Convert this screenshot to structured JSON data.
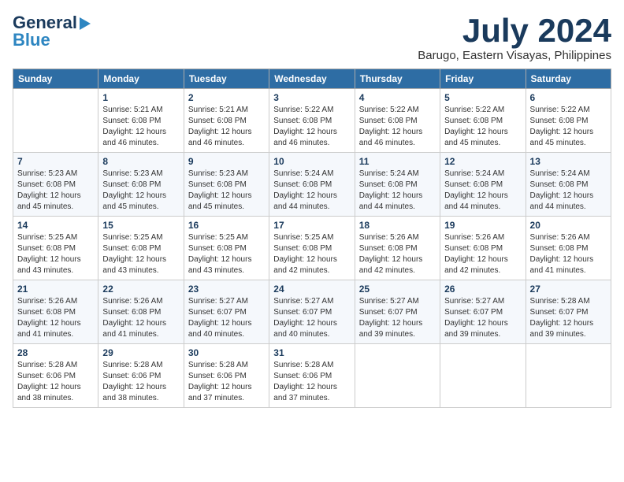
{
  "header": {
    "logo_line1": "General",
    "logo_line2": "Blue",
    "month": "July 2024",
    "location": "Barugo, Eastern Visayas, Philippines"
  },
  "days_of_week": [
    "Sunday",
    "Monday",
    "Tuesday",
    "Wednesday",
    "Thursday",
    "Friday",
    "Saturday"
  ],
  "weeks": [
    [
      {
        "day": "",
        "info": ""
      },
      {
        "day": "1",
        "info": "Sunrise: 5:21 AM\nSunset: 6:08 PM\nDaylight: 12 hours\nand 46 minutes."
      },
      {
        "day": "2",
        "info": "Sunrise: 5:21 AM\nSunset: 6:08 PM\nDaylight: 12 hours\nand 46 minutes."
      },
      {
        "day": "3",
        "info": "Sunrise: 5:22 AM\nSunset: 6:08 PM\nDaylight: 12 hours\nand 46 minutes."
      },
      {
        "day": "4",
        "info": "Sunrise: 5:22 AM\nSunset: 6:08 PM\nDaylight: 12 hours\nand 46 minutes."
      },
      {
        "day": "5",
        "info": "Sunrise: 5:22 AM\nSunset: 6:08 PM\nDaylight: 12 hours\nand 45 minutes."
      },
      {
        "day": "6",
        "info": "Sunrise: 5:22 AM\nSunset: 6:08 PM\nDaylight: 12 hours\nand 45 minutes."
      }
    ],
    [
      {
        "day": "7",
        "info": "Sunrise: 5:23 AM\nSunset: 6:08 PM\nDaylight: 12 hours\nand 45 minutes."
      },
      {
        "day": "8",
        "info": "Sunrise: 5:23 AM\nSunset: 6:08 PM\nDaylight: 12 hours\nand 45 minutes."
      },
      {
        "day": "9",
        "info": "Sunrise: 5:23 AM\nSunset: 6:08 PM\nDaylight: 12 hours\nand 45 minutes."
      },
      {
        "day": "10",
        "info": "Sunrise: 5:24 AM\nSunset: 6:08 PM\nDaylight: 12 hours\nand 44 minutes."
      },
      {
        "day": "11",
        "info": "Sunrise: 5:24 AM\nSunset: 6:08 PM\nDaylight: 12 hours\nand 44 minutes."
      },
      {
        "day": "12",
        "info": "Sunrise: 5:24 AM\nSunset: 6:08 PM\nDaylight: 12 hours\nand 44 minutes."
      },
      {
        "day": "13",
        "info": "Sunrise: 5:24 AM\nSunset: 6:08 PM\nDaylight: 12 hours\nand 44 minutes."
      }
    ],
    [
      {
        "day": "14",
        "info": "Sunrise: 5:25 AM\nSunset: 6:08 PM\nDaylight: 12 hours\nand 43 minutes."
      },
      {
        "day": "15",
        "info": "Sunrise: 5:25 AM\nSunset: 6:08 PM\nDaylight: 12 hours\nand 43 minutes."
      },
      {
        "day": "16",
        "info": "Sunrise: 5:25 AM\nSunset: 6:08 PM\nDaylight: 12 hours\nand 43 minutes."
      },
      {
        "day": "17",
        "info": "Sunrise: 5:25 AM\nSunset: 6:08 PM\nDaylight: 12 hours\nand 42 minutes."
      },
      {
        "day": "18",
        "info": "Sunrise: 5:26 AM\nSunset: 6:08 PM\nDaylight: 12 hours\nand 42 minutes."
      },
      {
        "day": "19",
        "info": "Sunrise: 5:26 AM\nSunset: 6:08 PM\nDaylight: 12 hours\nand 42 minutes."
      },
      {
        "day": "20",
        "info": "Sunrise: 5:26 AM\nSunset: 6:08 PM\nDaylight: 12 hours\nand 41 minutes."
      }
    ],
    [
      {
        "day": "21",
        "info": "Sunrise: 5:26 AM\nSunset: 6:08 PM\nDaylight: 12 hours\nand 41 minutes."
      },
      {
        "day": "22",
        "info": "Sunrise: 5:26 AM\nSunset: 6:08 PM\nDaylight: 12 hours\nand 41 minutes."
      },
      {
        "day": "23",
        "info": "Sunrise: 5:27 AM\nSunset: 6:07 PM\nDaylight: 12 hours\nand 40 minutes."
      },
      {
        "day": "24",
        "info": "Sunrise: 5:27 AM\nSunset: 6:07 PM\nDaylight: 12 hours\nand 40 minutes."
      },
      {
        "day": "25",
        "info": "Sunrise: 5:27 AM\nSunset: 6:07 PM\nDaylight: 12 hours\nand 39 minutes."
      },
      {
        "day": "26",
        "info": "Sunrise: 5:27 AM\nSunset: 6:07 PM\nDaylight: 12 hours\nand 39 minutes."
      },
      {
        "day": "27",
        "info": "Sunrise: 5:28 AM\nSunset: 6:07 PM\nDaylight: 12 hours\nand 39 minutes."
      }
    ],
    [
      {
        "day": "28",
        "info": "Sunrise: 5:28 AM\nSunset: 6:06 PM\nDaylight: 12 hours\nand 38 minutes."
      },
      {
        "day": "29",
        "info": "Sunrise: 5:28 AM\nSunset: 6:06 PM\nDaylight: 12 hours\nand 38 minutes."
      },
      {
        "day": "30",
        "info": "Sunrise: 5:28 AM\nSunset: 6:06 PM\nDaylight: 12 hours\nand 37 minutes."
      },
      {
        "day": "31",
        "info": "Sunrise: 5:28 AM\nSunset: 6:06 PM\nDaylight: 12 hours\nand 37 minutes."
      },
      {
        "day": "",
        "info": ""
      },
      {
        "day": "",
        "info": ""
      },
      {
        "day": "",
        "info": ""
      }
    ]
  ]
}
